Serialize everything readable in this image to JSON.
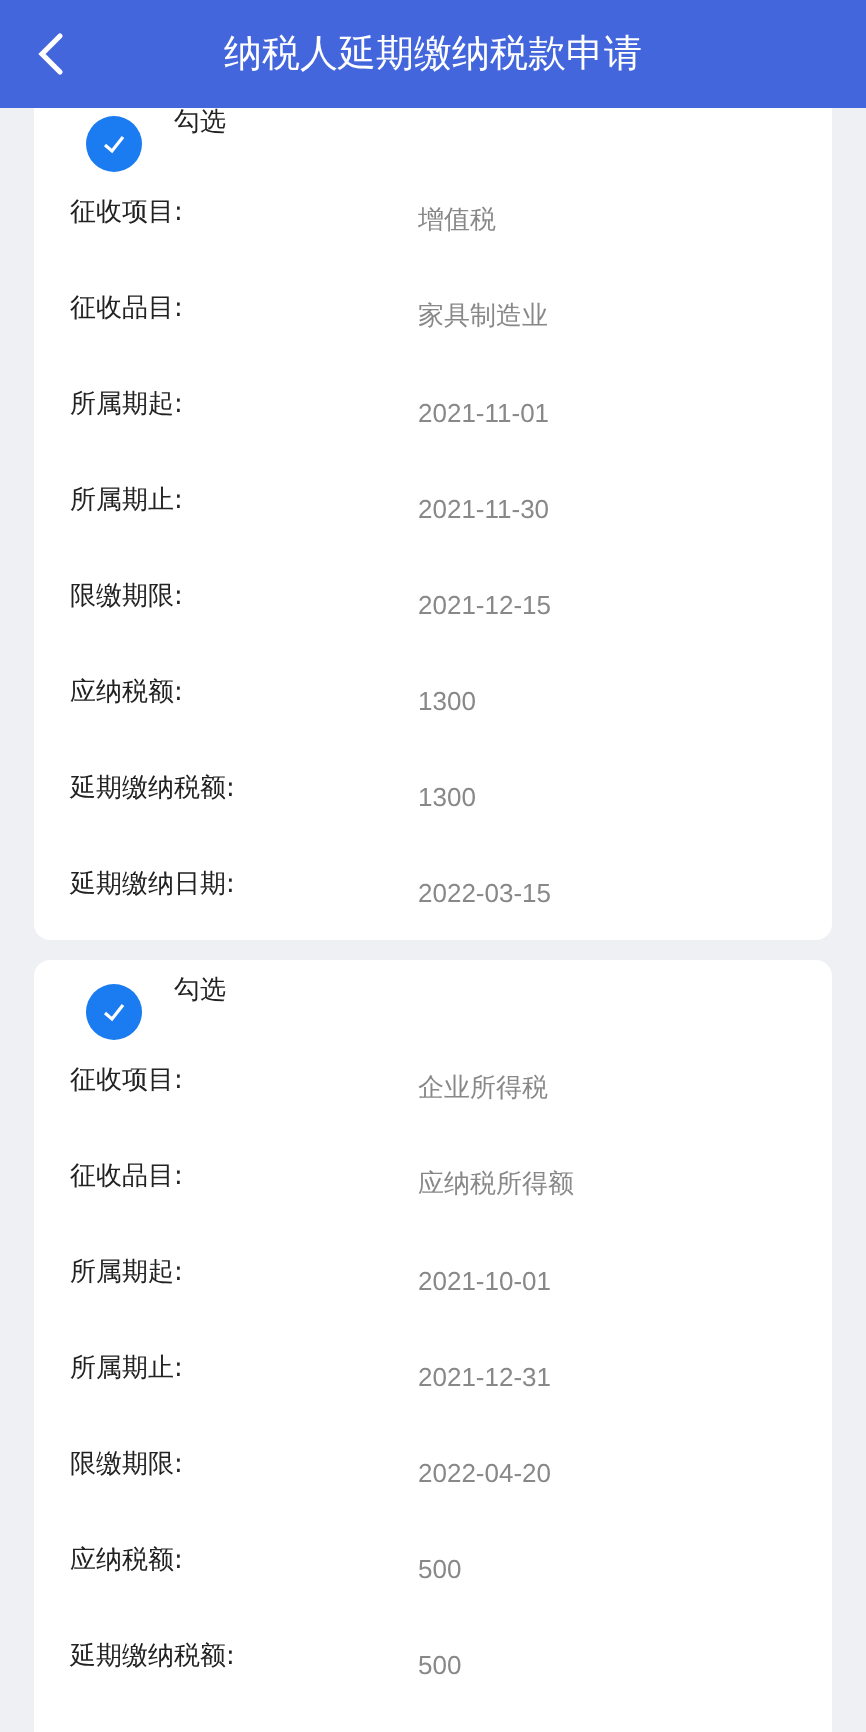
{
  "header": {
    "title": "纳税人延期缴纳税款申请"
  },
  "records": [
    {
      "check_label": "勾选",
      "checked": true,
      "fields": [
        {
          "label": "征收项目:",
          "value": "增值税"
        },
        {
          "label": "征收品目:",
          "value": "家具制造业"
        },
        {
          "label": "所属期起:",
          "value": "2021-11-01"
        },
        {
          "label": "所属期止:",
          "value": "2021-11-30"
        },
        {
          "label": "限缴期限:",
          "value": "2021-12-15"
        },
        {
          "label": "应纳税额:",
          "value": "1300"
        },
        {
          "label": "延期缴纳税额:",
          "value": "1300"
        },
        {
          "label": "延期缴纳日期:",
          "value": "2022-03-15"
        }
      ]
    },
    {
      "check_label": "勾选",
      "checked": true,
      "fields": [
        {
          "label": "征收项目:",
          "value": "企业所得税"
        },
        {
          "label": "征收品目:",
          "value": "应纳税所得额"
        },
        {
          "label": "所属期起:",
          "value": "2021-10-01"
        },
        {
          "label": "所属期止:",
          "value": "2021-12-31"
        },
        {
          "label": "限缴期限:",
          "value": "2022-04-20"
        },
        {
          "label": "应纳税额:",
          "value": "500"
        },
        {
          "label": "延期缴纳税额:",
          "value": "500"
        }
      ]
    }
  ]
}
